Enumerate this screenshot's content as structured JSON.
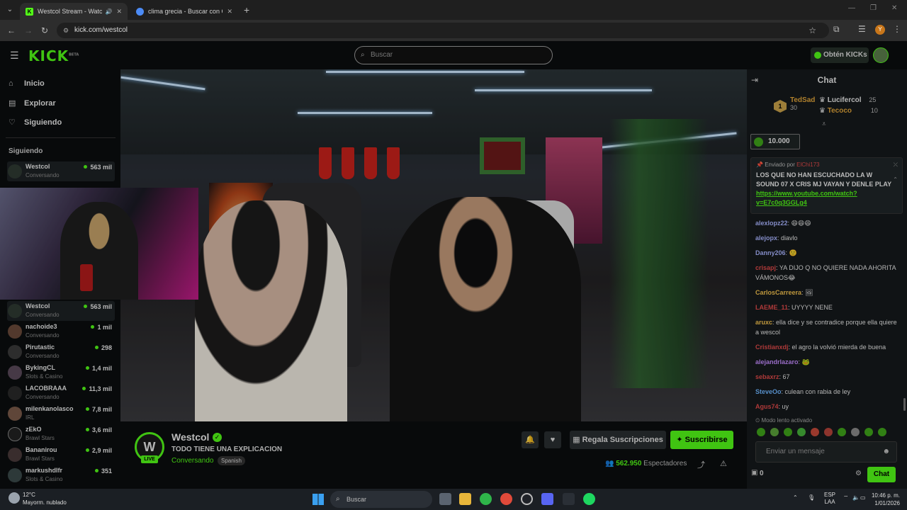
{
  "browser": {
    "tabs": [
      {
        "title": "Westcol Stream - Watch Live",
        "active": true
      },
      {
        "title": "clima grecia - Buscar con Google",
        "active": false
      }
    ],
    "url": "kick.com/westcol",
    "profile_initial": "Y"
  },
  "header": {
    "logo": "KICK",
    "logo_sup": "BETA",
    "search_placeholder": "Buscar",
    "get_kicks_label": "Obtén KICKs"
  },
  "sidebar": {
    "nav": [
      {
        "label": "Inicio",
        "icon": "home-icon"
      },
      {
        "label": "Explorar",
        "icon": "explore-icon"
      },
      {
        "label": "Siguiendo",
        "icon": "heart-icon"
      }
    ],
    "section_title": "Siguiendo",
    "top_channel": {
      "name": "Westcol",
      "category": "Conversando",
      "viewers": "563 mil"
    },
    "channels": [
      {
        "name": "Westcol",
        "category": "Conversando",
        "viewers": "563 mil"
      },
      {
        "name": "nachoide3",
        "category": "Conversando",
        "viewers": "1 mil"
      },
      {
        "name": "Pirutastic",
        "category": "Conversando",
        "viewers": "298"
      },
      {
        "name": "BykingCL",
        "category": "Slots & Casino",
        "viewers": "1,4 mil"
      },
      {
        "name": "LACOBRAAA",
        "category": "Conversando",
        "viewers": "11,3 mil"
      },
      {
        "name": "milenkanolasco",
        "category": "IRL",
        "viewers": "7,8 mil"
      },
      {
        "name": "zEkO",
        "category": "Brawl Stars",
        "viewers": "3,6 mil"
      },
      {
        "name": "Bananirou",
        "category": "Brawl Stars",
        "viewers": "2,9 mil"
      },
      {
        "name": "markushdlfr",
        "category": "Slots & Casino",
        "viewers": "351"
      }
    ]
  },
  "stream": {
    "channel_name": "Westcol",
    "avatar_text": "W",
    "live_label": "LIVE",
    "title": "TODO TIENE UNA EXPLICACION",
    "category": "Conversando",
    "language": "Spanish",
    "gift_label": "Regala Suscripciones",
    "subscribe_label": "Suscribirse",
    "viewers_count": "562.950",
    "viewers_label": "Espectadores"
  },
  "chat": {
    "title": "Chat",
    "leaderboard": [
      {
        "name": "TedSad",
        "value": "30",
        "color": "#e0a43a"
      },
      {
        "name": "Lucifercol",
        "value": "25",
        "color": "#e8e8e8"
      },
      {
        "name": "Tecoco",
        "value": "10",
        "color": "#e0a43a"
      }
    ],
    "rank_badge": "1",
    "kicks_amount": "10.000",
    "pinned": {
      "sent_by_label": "Enviado por",
      "sender": "ElChi173",
      "text": "LOS QUE NO HAN ESCUCHADO LA W SOUND 07 X CRIS MJ VAYAN Y DENLE PLAY",
      "link": "https://www.youtube.com/watch?v=E7c0q3GGLg4"
    },
    "messages": [
      {
        "user": "alexlopz22",
        "color": "#a9b4ff",
        "text": " 😄😄😄"
      },
      {
        "user": "alejopx",
        "color": "#a9b4ff",
        "text": " diavlo"
      },
      {
        "user": "Danny206",
        "color": "#a9b4ff",
        "text": " 🙂"
      },
      {
        "user": "crisapj",
        "color": "#e04a4a",
        "text": " YA DIJO Q NO QUIERE NADA AHORITA VÁMONOS😂"
      },
      {
        "user": "CarlosCarreera",
        "color": "#f2c14e",
        "text": " 🖼"
      },
      {
        "user": "LAEME_11",
        "color": "#e04a4a",
        "text": " UYYYY NENE"
      },
      {
        "user": "aruxc",
        "color": "#f2c14e",
        "text": " ella dice y se contradice porque ella quiere a wescol"
      },
      {
        "user": "Cristianxdj",
        "color": "#e04a4a",
        "text": " el agro la volvió mierda de buena"
      },
      {
        "user": "alejandrlazaro",
        "color": "#c48bff",
        "text": " 🐸"
      },
      {
        "user": "sebaxrz",
        "color": "#e04a4a",
        "text": " 67"
      },
      {
        "user": "SteveOo",
        "color": "#6fb6ff",
        "text": " culean con rabia de ley"
      },
      {
        "user": "Agus74",
        "color": "#e04a4a",
        "text": " uy"
      }
    ],
    "slow_mode": "Modo lento activado",
    "input_placeholder": "Enviar un mensaje",
    "points": "0",
    "send_label": "Chat"
  },
  "taskbar": {
    "temp": "12°C",
    "weather": "Mayorm. nublado",
    "search_placeholder": "Buscar",
    "lang": "ESP",
    "lang2": "LAA",
    "time": "10:46 p. m.",
    "date": "1/01/2026"
  }
}
